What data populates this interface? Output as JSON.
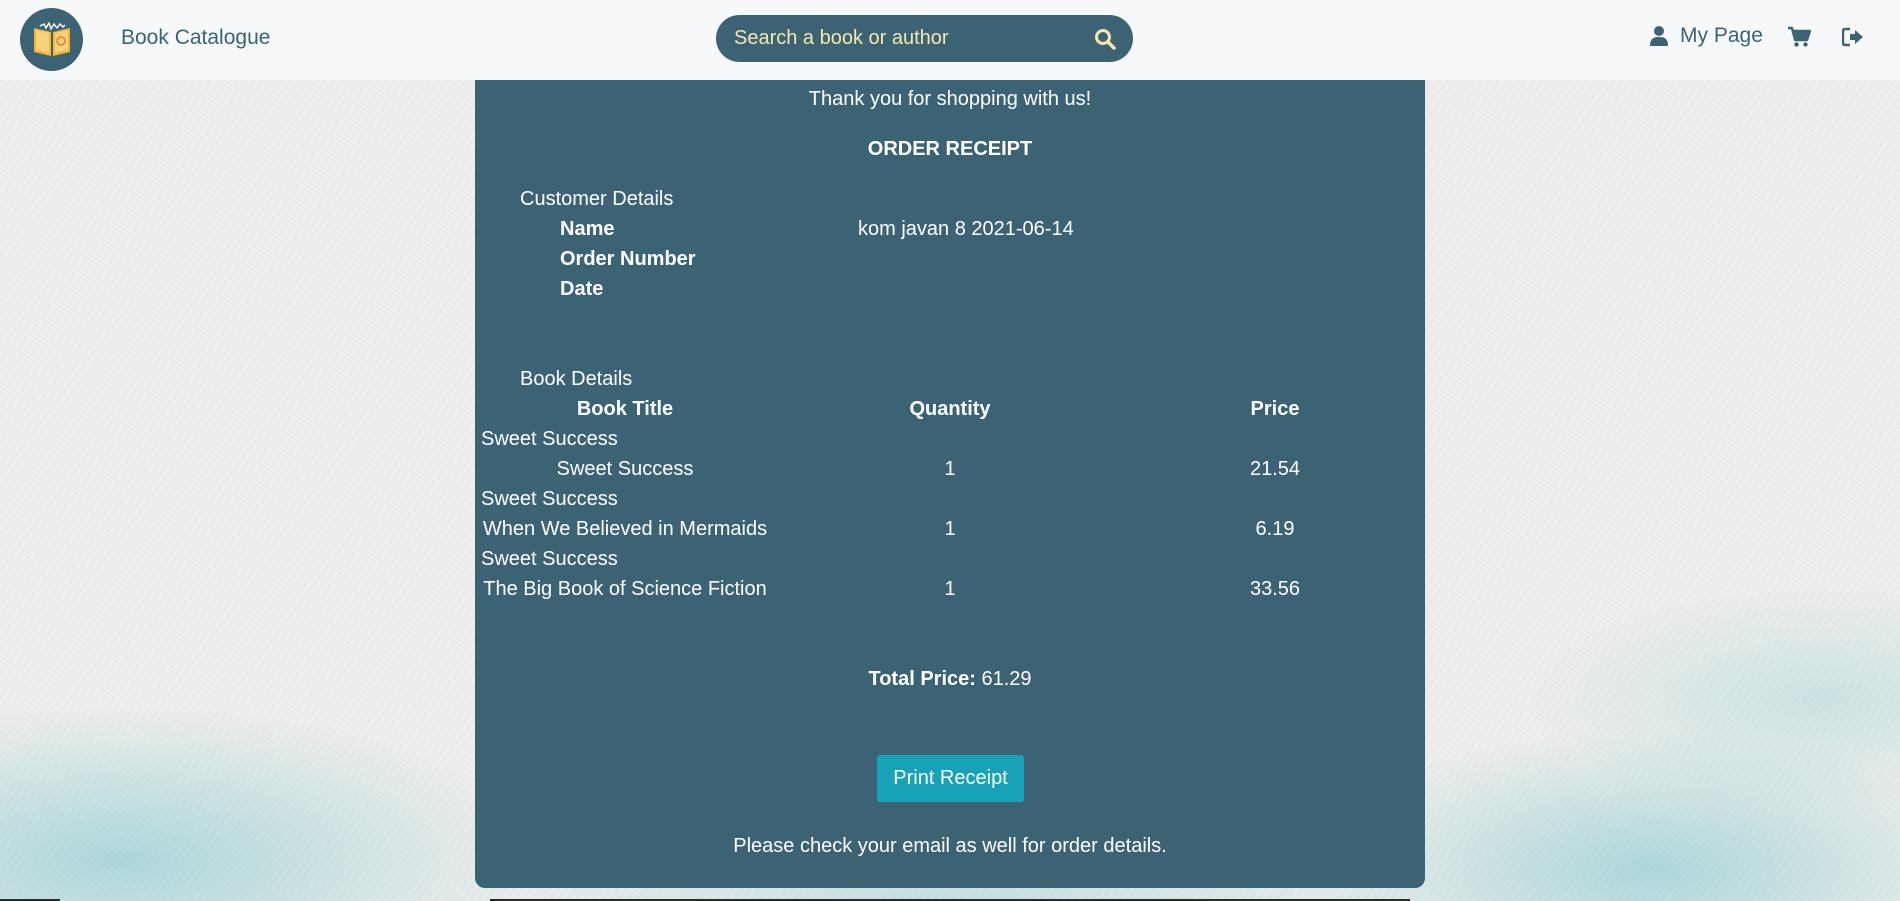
{
  "nav": {
    "brand": "Book Catalogue",
    "search_placeholder": "Search a book or author",
    "my_page": "My Page",
    "icons": {
      "logo": "book-logo-icon",
      "search": "search-icon",
      "user": "user-icon",
      "cart": "shopping-cart-icon",
      "logout": "sign-out-icon"
    }
  },
  "receipt": {
    "thanks": "Thank you for shopping with us!",
    "title": "ORDER RECEIPT",
    "customer_section": "Customer Details",
    "labels": {
      "name": "Name",
      "order_number": "Order Number",
      "date": "Date"
    },
    "customer_value": "kom javan 8 2021-06-14",
    "book_section": "Book Details",
    "columns": {
      "title": "Book Title",
      "quantity": "Quantity",
      "price": "Price"
    },
    "items": [
      {
        "group": "Sweet Success",
        "title": "Sweet Success",
        "quantity": "1",
        "price": "21.54"
      },
      {
        "group": "Sweet Success",
        "title": "When We Believed in Mermaids",
        "quantity": "1",
        "price": "6.19"
      },
      {
        "group": "Sweet Success",
        "title": "The Big Book of Science Fiction",
        "quantity": "1",
        "price": "33.56"
      }
    ],
    "total_label": "Total Price:",
    "total_value": "61.29",
    "print_button": "Print Receipt",
    "footer_note": "Please check your email as well for order details."
  },
  "colors": {
    "primary": "#3b6374",
    "accent": "#17a2b8",
    "search_text": "#f5e7b0",
    "nav_bg": "#f6f8fa"
  }
}
